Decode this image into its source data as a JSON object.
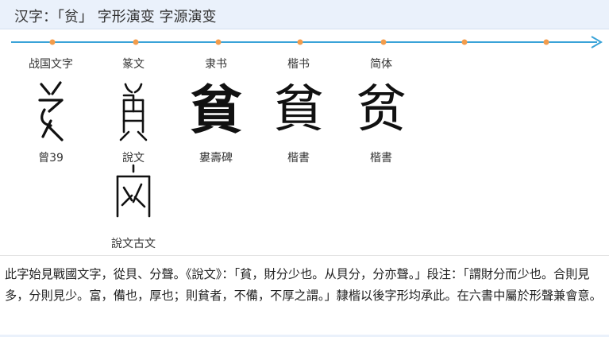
{
  "header": {
    "title": "汉字：「贫」 字形演变 字源演变"
  },
  "timeline": {
    "line_color": "#3aa3d8",
    "dot_color": "#f39c4b",
    "marker_count": 7
  },
  "columns": [
    {
      "label": "战国文字",
      "glyph_char": "",
      "glyph_icon": "warring-states-pin-glyph-icon",
      "source": "曾39"
    },
    {
      "label": "篆文",
      "glyph_char": "",
      "glyph_icon": "seal-script-pin-glyph-icon",
      "source": "說文"
    },
    {
      "label": "隶书",
      "glyph_char": "貧",
      "glyph_icon": "clerical-pin-glyph-icon",
      "source": "婁壽碑"
    },
    {
      "label": "楷书",
      "glyph_char": "貧",
      "glyph_icon": "regular-pin-glyph-icon",
      "source": "楷書"
    },
    {
      "label": "简体",
      "glyph_char": "贫",
      "glyph_icon": "simplified-pin-glyph-icon",
      "source": "楷書"
    }
  ],
  "extra": {
    "source": "說文古文",
    "glyph_icon": "ancient-script-pin-glyph-icon"
  },
  "description": "此字始見戰國文字，從貝、分聲。《說文》：「貧，財分少也。从貝分，分亦聲。」段注：「謂財分而少也。合則見多，分則見少。富，備也，厚也；則貧者，不備，不厚之謂。」隸楷以後字形均承此。在六書中屬於形聲兼會意。"
}
